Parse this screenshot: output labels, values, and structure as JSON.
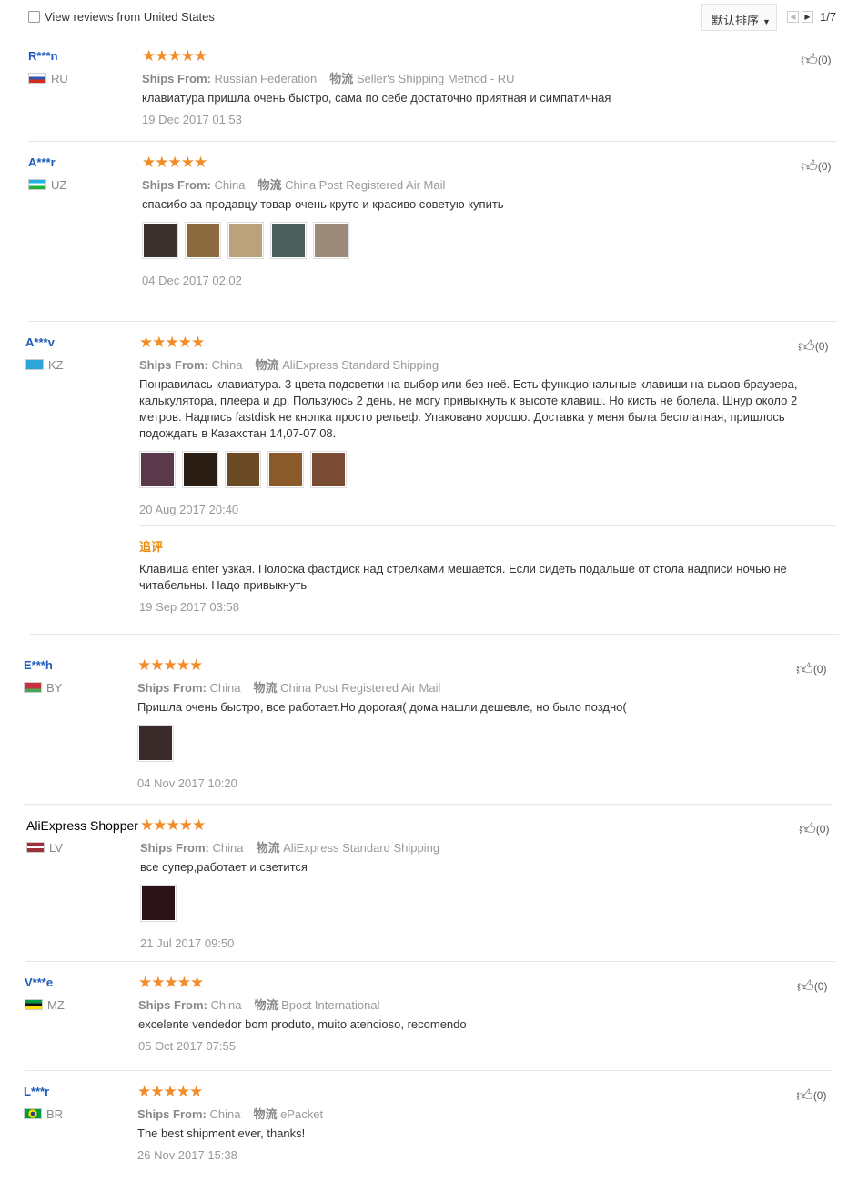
{
  "topbar": {
    "filter_label": "View reviews from United States",
    "sort_label": "默认排序",
    "page_indicator": "1/7"
  },
  "stars": "★★★★★",
  "ships_from_label": "Ships From:",
  "shipping_method_label": "物流",
  "reviews": [
    {
      "user": "R***n",
      "country": "RU",
      "ship_from": "Russian Federation",
      "method": "Seller's Shipping Method - RU",
      "text": "клавиатура пришла очень быстро, сама по себе достаточно приятная и симпатичная",
      "date": "19 Dec 2017 01:53",
      "likes": "(0)"
    },
    {
      "user": "A***r",
      "country": "UZ",
      "ship_from": "China",
      "method": "China Post Registered Air Mail",
      "text": "спасибо за продавцу товар очень круто и красиво советую купить",
      "date": "04 Dec 2017 02:02",
      "likes": "(0)",
      "photos": [
        "#3b3230",
        "#8a6a3e",
        "#b9a27c",
        "#4a5f5b",
        "#9c8b7a"
      ]
    },
    {
      "user": "A***v",
      "country": "KZ",
      "ship_from": "China",
      "method": "AliExpress Standard Shipping",
      "text": "Понравилась клавиатура. 3 цвета подсветки на выбор или без неё. Есть функциональные клавиши на вызов браузера, калькулятора, плеера и др. Пользуюсь 2 день, не могу привыкнуть к высоте клавиш. Но кисть не болела. Шнур около 2 метров. Надпись fastdisk не кнопка просто рельеф. Упаковано хорошо. Доставка у меня была бесплатная, пришлось подождать в Казахстан 14,07-07,08.",
      "date": "20 Aug 2017 20:40",
      "likes": "(0)",
      "photos": [
        "#5a3a4a",
        "#2a1d14",
        "#6b4a26",
        "#8a5a2a",
        "#7a4b33"
      ],
      "followup_title": "追评",
      "followup_text": "Клавиша enter узкая. Полоска фастдиск над стрелками мешается. Если сидеть подальше от стола надписи ночью не читабельны. Надо привыкнуть",
      "followup_date": "19 Sep 2017 03:58"
    },
    {
      "user": "E***h",
      "country": "BY",
      "ship_from": "China",
      "method": "China Post Registered Air Mail",
      "text": "Пришла очень быстро, все работает.Но дорогая( дома нашли дешевле, но было поздно(",
      "date": "04 Nov 2017 10:20",
      "likes": "(0)",
      "photos": [
        "#3a2a2a"
      ]
    },
    {
      "user": "AliExpress Shopper",
      "country": "LV",
      "ship_from": "China",
      "method": "AliExpress Standard Shipping",
      "text": "все супер,работает и светится",
      "date": "21 Jul 2017 09:50",
      "likes": "(0)",
      "photos": [
        "#2a1418"
      ]
    },
    {
      "user": "V***e",
      "country": "MZ",
      "ship_from": "China",
      "method": "Bpost International",
      "text": "excelente vendedor bom produto, muito atencioso, recomendo",
      "date": "05 Oct 2017 07:55",
      "likes": "(0)"
    },
    {
      "user": "L***r",
      "country": "BR",
      "ship_from": "China",
      "method": "ePacket",
      "text": "The best shipment ever, thanks!",
      "date": "26 Nov 2017 15:38",
      "likes": "(0)"
    }
  ]
}
